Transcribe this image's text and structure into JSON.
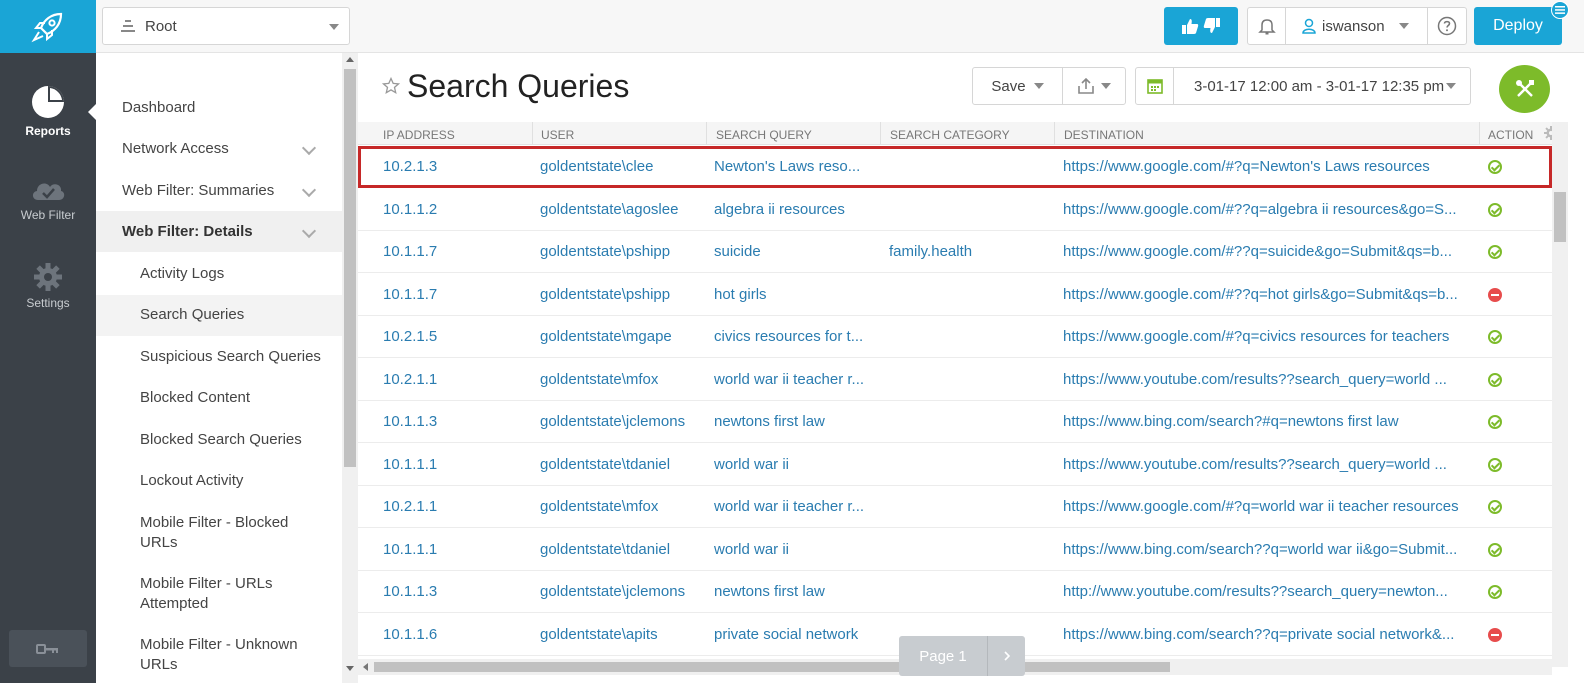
{
  "rail": {
    "items": [
      {
        "label": "Reports",
        "icon": "pie-chart-icon",
        "active": true
      },
      {
        "label": "Web Filter",
        "icon": "cloud-icon",
        "active": false
      },
      {
        "label": "Settings",
        "icon": "gear-icon",
        "active": false
      }
    ],
    "logo_icon": "rocket-icon",
    "bottom_icon": "key-icon"
  },
  "topbar": {
    "root_select": "Root",
    "user": "iswanson",
    "deploy": "Deploy"
  },
  "nav": {
    "sections": [
      {
        "label": "Dashboard"
      },
      {
        "label": "Network Access"
      },
      {
        "label": "Web Filter: Summaries"
      },
      {
        "label": "Web Filter: Details"
      }
    ],
    "subitems": [
      {
        "label": "Activity Logs"
      },
      {
        "label": "Search Queries"
      },
      {
        "label": "Suspicious Search Queries"
      },
      {
        "label": "Blocked Content"
      },
      {
        "label": "Blocked Search Queries"
      },
      {
        "label": "Lockout Activity"
      },
      {
        "label": "Mobile Filter - Blocked URLs"
      },
      {
        "label": "Mobile Filter - URLs Attempted"
      },
      {
        "label": "Mobile Filter - Unknown URLs"
      }
    ]
  },
  "main": {
    "title": "Search Queries",
    "save_label": "Save",
    "date_range": "3-01-17 12:00 am - 3-01-17 12:35 pm",
    "columns": [
      "IP ADDRESS",
      "USER",
      "SEARCH QUERY",
      "SEARCH CATEGORY",
      "DESTINATION",
      "ACTION"
    ],
    "rows": [
      {
        "ip": "10.2.1.3",
        "user": "goldentstate\\clee",
        "query": "Newton's Laws reso...",
        "category": "",
        "dest": "https://www.google.com/#?q=Newton's Laws resources",
        "action": "allowed"
      },
      {
        "ip": "10.1.1.2",
        "user": "goldentstate\\agoslee",
        "query": "algebra ii resources",
        "category": "",
        "dest": "https://www.google.com/#??q=algebra ii resources&go=S...",
        "action": "allowed"
      },
      {
        "ip": "10.1.1.7",
        "user": "goldentstate\\pshipp",
        "query": "suicide",
        "category": "family.health",
        "dest": "https://www.google.com/#??q=suicide&go=Submit&qs=b...",
        "action": "allowed"
      },
      {
        "ip": "10.1.1.7",
        "user": "goldentstate\\pshipp",
        "query": "hot girls",
        "category": "",
        "dest": "https://www.google.com/#??q=hot girls&go=Submit&qs=b...",
        "action": "blocked"
      },
      {
        "ip": "10.2.1.5",
        "user": "goldentstate\\mgape",
        "query": "civics resources for t...",
        "category": "",
        "dest": "https://www.google.com/#?q=civics resources for teachers",
        "action": "allowed"
      },
      {
        "ip": "10.2.1.1",
        "user": "goldentstate\\mfox",
        "query": "world war ii teacher r...",
        "category": "",
        "dest": "https://www.youtube.com/results??search_query=world ...",
        "action": "allowed"
      },
      {
        "ip": "10.1.1.3",
        "user": "goldentstate\\jclemons",
        "query": "newtons first law",
        "category": "",
        "dest": "https://www.bing.com/search?#q=newtons first law",
        "action": "allowed"
      },
      {
        "ip": "10.1.1.1",
        "user": "goldentstate\\tdaniel",
        "query": "world war ii",
        "category": "",
        "dest": "https://www.youtube.com/results??search_query=world ...",
        "action": "allowed"
      },
      {
        "ip": "10.2.1.1",
        "user": "goldentstate\\mfox",
        "query": "world war ii teacher r...",
        "category": "",
        "dest": "https://www.google.com/#?q=world war ii teacher resources",
        "action": "allowed"
      },
      {
        "ip": "10.1.1.1",
        "user": "goldentstate\\tdaniel",
        "query": "world war ii",
        "category": "",
        "dest": "https://www.bing.com/search??q=world war ii&go=Submit...",
        "action": "allowed"
      },
      {
        "ip": "10.1.1.3",
        "user": "goldentstate\\jclemons",
        "query": "newtons first law",
        "category": "",
        "dest": "http://www.youtube.com/results??search_query=newton...",
        "action": "allowed"
      },
      {
        "ip": "10.1.1.6",
        "user": "goldentstate\\apits",
        "query": "private social network",
        "category": "",
        "dest": "https://www.bing.com/search??q=private social network&...",
        "action": "blocked"
      }
    ],
    "pager_label": "Page 1"
  },
  "colors": {
    "brand_blue": "#1aa5d6",
    "rail_bg": "#3b4148",
    "link": "#2a7cb0",
    "ok_green": "#7dbb2a",
    "blocked_red": "#e74c4c",
    "highlight_red": "#c62828"
  }
}
